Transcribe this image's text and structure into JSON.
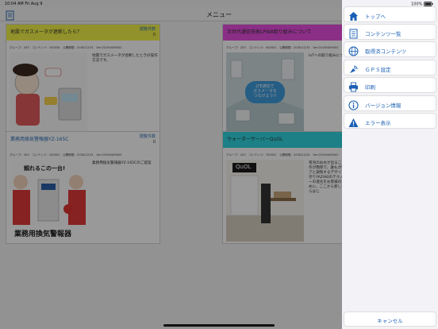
{
  "status": {
    "time": "10:04 AM",
    "date": "Fri Aug 9",
    "battery": "100%"
  },
  "nav": {
    "title": "メニュー"
  },
  "cards": [
    {
      "title": "地震でガスメータが遮断したら？",
      "count_label": "閲覧件数",
      "count": "0",
      "meta": "グループ：203　コンテンツ：100034　公開期限：2030/12/31　Ver:20190409002",
      "desc": "地震でガスメータが遮断したときの操作方法です。",
      "head_color": "#f3f34a"
    },
    {
      "title": "次世代通信技術LPWA取り組みについて",
      "count_label": "",
      "count": "",
      "meta": "グループ：203　コンテンツ：500001　公開期限：2030/12/31　Ver:20190409002",
      "desc": "IoTへの取り組みについて",
      "thumb_text": "LTE通信で\nガスメータを\nつなげよう!!",
      "head_color": "#e84de0"
    },
    {
      "title": "業務用換気警報器YZ-165C",
      "count_label": "閲覧件数",
      "count": "0",
      "meta": "グループ：203　コンテンツ：200002　公開期限：2030/12/31　Ver:20190409005",
      "desc": "業務用換気警報器YZ-165Cのご提案",
      "thumb_text": "頼れるこの一台!",
      "thumb_caption": "業務用換気警報器",
      "head_color": "#ffffff"
    },
    {
      "title": "ウォーターサーバーQuOL",
      "count_label": "",
      "count": "",
      "meta": "グループ：203　コンテンツ：700001　公開期限：2030/12/31　Ver:20190409002",
      "desc": "育児のお水が出ることができること。操作が簡単で、誰もが安心して使える。リアと調和するデザインに。人々の資源を守りYAZAKIのテクノロジーで、サーバーの進化をお客様の生活を豊かにするために、ここから新しいションが、ここからはじ",
      "thumb_text": "QuOL",
      "head_color": "#2fd6e0"
    }
  ],
  "menu": {
    "items": [
      {
        "label": "トップへ",
        "icon": "home-icon"
      },
      {
        "label": "コンテンツ一覧",
        "icon": "book-icon"
      },
      {
        "label": "取得済コンテンツ",
        "icon": "globe-icon"
      },
      {
        "label": "ＧＰＳ設定",
        "icon": "gps-icon"
      },
      {
        "label": "印刷",
        "icon": "printer-icon"
      },
      {
        "label": "バージョン情報",
        "icon": "info-icon"
      },
      {
        "label": "エラー表示",
        "icon": "warning-icon"
      }
    ],
    "cancel": "キャンセル"
  },
  "colors": {
    "accent": "#1a5fb4",
    "sheet_bg": "#f2f2f7"
  }
}
